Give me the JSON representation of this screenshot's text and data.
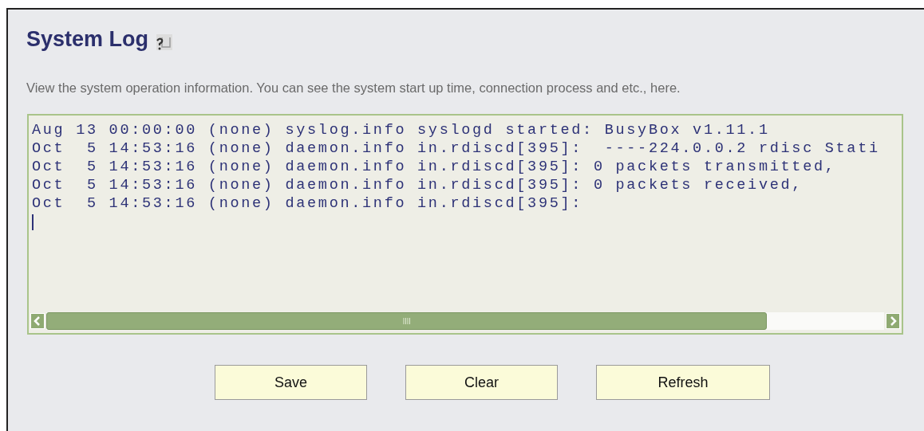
{
  "title": "System Log",
  "description": "View the system operation information. You can see the system start up time, connection process and etc., here.",
  "log": {
    "lines": [
      "Aug 13 00:00:00 (none) syslog.info syslogd started: BusyBox v1.11.1",
      "Oct  5 14:53:16 (none) daemon.info in.rdiscd[395]:  ----224.0.0.2 rdisc Stati",
      "Oct  5 14:53:16 (none) daemon.info in.rdiscd[395]: 0 packets transmitted,",
      "Oct  5 14:53:16 (none) daemon.info in.rdiscd[395]: 0 packets received,",
      "Oct  5 14:53:16 (none) daemon.info in.rdiscd[395]:"
    ]
  },
  "buttons": [
    "Save",
    "Clear",
    "Refresh"
  ]
}
